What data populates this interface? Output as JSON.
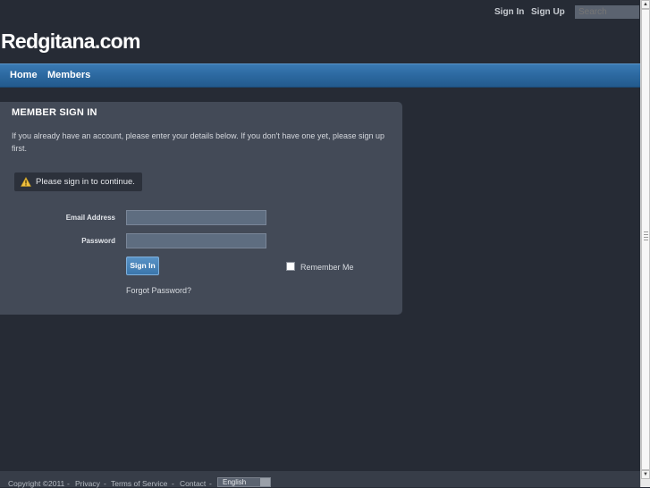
{
  "header": {
    "sign_in": "Sign In",
    "sign_up": "Sign Up",
    "search_placeholder": "Search",
    "site_title": "Redgitana.com"
  },
  "nav": {
    "items": [
      {
        "label": "Home"
      },
      {
        "label": "Members"
      }
    ]
  },
  "signin_panel": {
    "heading": "MEMBER SIGN IN",
    "intro": "If you already have an account, please enter your details below. If you don't have one yet, please sign up first.",
    "notice": "Please sign in to continue.",
    "email_label": "Email Address",
    "email_value": "",
    "password_label": "Password",
    "password_value": "",
    "submit_label": "Sign In",
    "remember_label": "Remember Me",
    "forgot_label": "Forgot Password?"
  },
  "footer": {
    "copyright": "Copyright ©2011",
    "links": [
      "Privacy",
      "Terms of Service",
      "Contact"
    ],
    "separator": "-",
    "language": "English"
  },
  "colors": {
    "background": "#262b35",
    "nav_blue": "#2d6aa2",
    "panel": "#434a57",
    "warning": "#f0c040"
  }
}
